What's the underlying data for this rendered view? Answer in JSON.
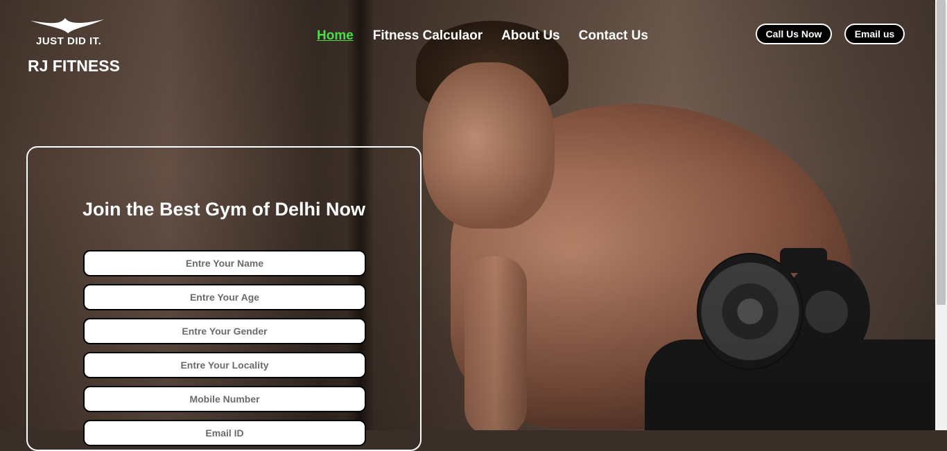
{
  "logo": {
    "icon": "wing-swoosh-icon",
    "slogan": "JUST DID IT."
  },
  "brand": {
    "name": "RJ FITNESS"
  },
  "nav": {
    "items": [
      {
        "label": "Home",
        "active": true
      },
      {
        "label": "Fitness Calculaor",
        "active": false
      },
      {
        "label": "About Us",
        "active": false
      },
      {
        "label": "Contact Us",
        "active": false
      }
    ],
    "active_color": "#4ade4a"
  },
  "actions": {
    "call_label": "Call Us Now",
    "email_label": "Email us"
  },
  "form": {
    "title": "Join the Best Gym of Delhi Now",
    "fields": [
      {
        "placeholder": "Entre Your Name"
      },
      {
        "placeholder": "Entre Your Age"
      },
      {
        "placeholder": "Entre Your Gender"
      },
      {
        "placeholder": "Entre Your Locality"
      },
      {
        "placeholder": "Mobile Number"
      },
      {
        "placeholder": "Email ID"
      }
    ]
  },
  "hero": {
    "image": "man-lifting-dumbbell-photo"
  }
}
